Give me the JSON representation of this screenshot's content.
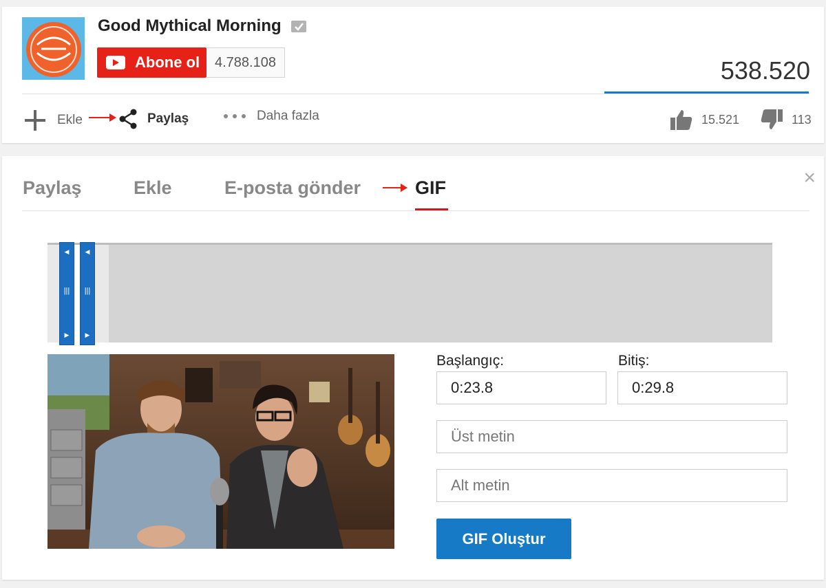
{
  "channel": {
    "name": "Good Mythical Morning",
    "subscribe_label": "Abone ol",
    "subscriber_count": "4.788.108",
    "view_count": "538.520",
    "avatar_colors": {
      "bg": "#5cb8e6",
      "badge": "#f0622b"
    }
  },
  "actions": {
    "add_label": "Ekle",
    "share_label": "Paylaş",
    "more_label": "Daha fazla",
    "like_count": "15.521",
    "dislike_count": "113"
  },
  "share_panel": {
    "tabs": [
      {
        "label": "Paylaş"
      },
      {
        "label": "Ekle"
      },
      {
        "label": "E-posta gönder"
      },
      {
        "label": "GIF"
      }
    ],
    "active_tab": "GIF",
    "close_symbol": "×"
  },
  "gif_form": {
    "start_label": "Başlangıç:",
    "start_value": "0:23.8",
    "end_label": "Bitiş:",
    "end_value": "0:29.8",
    "top_text_placeholder": "Üst metin",
    "bottom_text_placeholder": "Alt metin",
    "create_button_label": "GIF Oluştur"
  },
  "colors": {
    "accent_red": "#e62117",
    "accent_blue": "#167ac6",
    "tab_underline": "#cc181e"
  }
}
